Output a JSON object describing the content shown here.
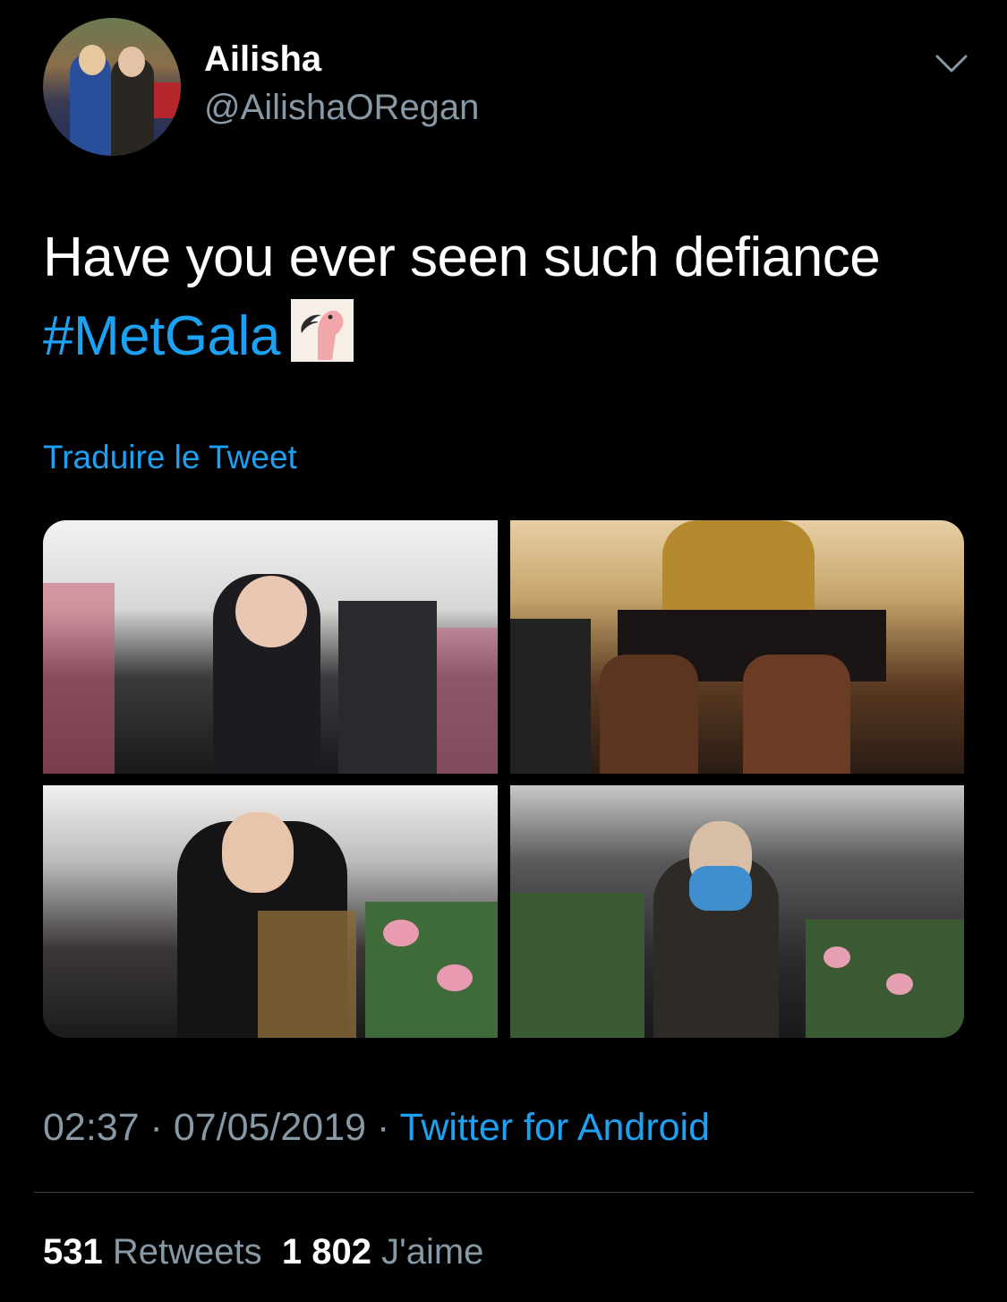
{
  "user": {
    "display_name": "Ailisha",
    "handle": "@AilishaORegan"
  },
  "tweet": {
    "text": "Have you ever seen such defiance",
    "hashtag": "#MetGala",
    "emoji": "flamingo-icon",
    "translate_label": "Traduire le Tweet"
  },
  "media": {
    "images": [
      {
        "name": "met-gala-photo-1"
      },
      {
        "name": "met-gala-photo-2"
      },
      {
        "name": "met-gala-photo-3"
      },
      {
        "name": "met-gala-photo-4"
      }
    ]
  },
  "meta": {
    "time": "02:37",
    "sep1": " · ",
    "date": "07/05/2019",
    "sep2": " · ",
    "source": "Twitter for Android"
  },
  "stats": {
    "retweets_count": "531",
    "retweets_label": "Retweets",
    "likes_count": "1 802",
    "likes_label": "J'aime"
  },
  "colors": {
    "background": "#000000",
    "accent": "#1da1f2",
    "secondary_text": "#8899a6",
    "divider": "#38444d"
  }
}
